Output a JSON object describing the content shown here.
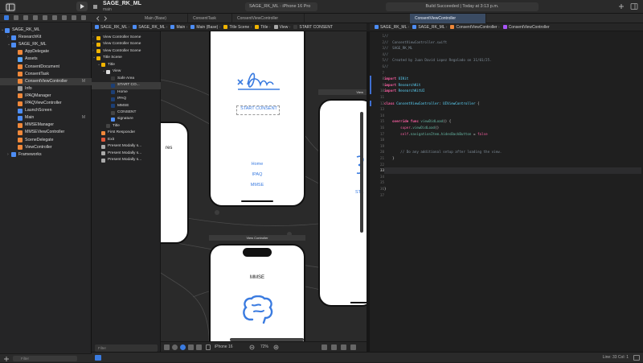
{
  "titlebar": {
    "project_name": "SAGE_RK_ML",
    "project_branch": "main",
    "scheme": "SAGE_RK_ML",
    "destination": "iPhone 16 Pro",
    "build_status": "Build Succeeded | Today at 3:13 p.m."
  },
  "navigator": {
    "filter_placeholder": "Filter",
    "items": [
      {
        "label": "SAGE_RK_ML",
        "kind": "project",
        "badge": ""
      },
      {
        "label": "ResearchKit",
        "kind": "project",
        "badge": ""
      },
      {
        "label": "SAGE_RK_ML",
        "kind": "folder",
        "badge": ""
      },
      {
        "label": "AppDelegate",
        "kind": "swift",
        "badge": ""
      },
      {
        "label": "Assets",
        "kind": "assets",
        "badge": ""
      },
      {
        "label": "ConsentDocument",
        "kind": "swift",
        "badge": ""
      },
      {
        "label": "ConsentTask",
        "kind": "swift",
        "badge": ""
      },
      {
        "label": "ConsentViewController",
        "kind": "swift",
        "badge": "M",
        "selected": true
      },
      {
        "label": "Info",
        "kind": "plist",
        "badge": ""
      },
      {
        "label": "IPAQManager",
        "kind": "swift",
        "badge": ""
      },
      {
        "label": "IPAQViewController",
        "kind": "swift",
        "badge": ""
      },
      {
        "label": "LaunchScreen",
        "kind": "storyboard",
        "badge": ""
      },
      {
        "label": "Main",
        "kind": "storyboard",
        "badge": "M"
      },
      {
        "label": "MMSEManager",
        "kind": "swift",
        "badge": ""
      },
      {
        "label": "MMSEViewController",
        "kind": "swift",
        "badge": ""
      },
      {
        "label": "SceneDelegate",
        "kind": "swift",
        "badge": ""
      },
      {
        "label": "ViewController",
        "kind": "swift",
        "badge": ""
      },
      {
        "label": "Frameworks",
        "kind": "folder",
        "badge": ""
      }
    ]
  },
  "tabs": [
    {
      "label": "Main (Base)",
      "active": false
    },
    {
      "label": "ConsentTask",
      "active": false
    },
    {
      "label": "ConsentViewController",
      "active": false
    },
    {
      "label": "ConsentViewController",
      "active": true
    }
  ],
  "left_jumpbar": [
    "SAGE_RK_ML",
    "SAGE_RK_ML",
    "Main",
    "Main (Base)",
    "Title Scene",
    "Title",
    "View",
    "START CONSENT"
  ],
  "right_jumpbar": [
    "SAGE_RK_ML",
    "SAGE_RK_ML",
    "ConsentViewController",
    "ConsentViewController"
  ],
  "outline": {
    "filter_placeholder": "Filter",
    "items": [
      {
        "label": "View Controller Scene",
        "depth": 0,
        "kind": "scene"
      },
      {
        "label": "View Controller Scene",
        "depth": 0,
        "kind": "scene"
      },
      {
        "label": "View Controller Scene",
        "depth": 0,
        "kind": "scene"
      },
      {
        "label": "Title Scene",
        "depth": 0,
        "kind": "scene"
      },
      {
        "label": "Title",
        "depth": 1,
        "kind": "vc"
      },
      {
        "label": "View",
        "depth": 2,
        "kind": "view"
      },
      {
        "label": "Safe Area",
        "depth": 3,
        "kind": "area"
      },
      {
        "label": "START CO...",
        "depth": 3,
        "kind": "button",
        "selected": true
      },
      {
        "label": "Home",
        "depth": 3,
        "kind": "button"
      },
      {
        "label": "IPAQ",
        "depth": 3,
        "kind": "button"
      },
      {
        "label": "MMSE",
        "depth": 3,
        "kind": "button"
      },
      {
        "label": "CONSENT",
        "depth": 3,
        "kind": "label"
      },
      {
        "label": "signature",
        "depth": 3,
        "kind": "image"
      },
      {
        "label": "Title",
        "depth": 2,
        "kind": "item"
      },
      {
        "label": "First Responder",
        "depth": 1,
        "kind": "responder"
      },
      {
        "label": "Exit",
        "depth": 1,
        "kind": "exit"
      },
      {
        "label": "Present Modally s...",
        "depth": 1,
        "kind": "segue"
      },
      {
        "label": "Present Modally s...",
        "depth": 1,
        "kind": "segue"
      },
      {
        "label": "Present Modally s...",
        "depth": 1,
        "kind": "segue"
      }
    ]
  },
  "canvas": {
    "title_scene": {
      "consent_button": "START CONSENT",
      "buttons": [
        "Home",
        "IPAQ",
        "MMSE"
      ]
    },
    "left_phone_fragment": "res",
    "view_controller_label": "View Controller",
    "mmse_scene_title": "MMSE",
    "right_phone_fragment": "STA",
    "right_scene_label": "View",
    "device": "iPhone 16",
    "zoom": "72%"
  },
  "code": {
    "lines": [
      {
        "n": 1,
        "t": "//"
      },
      {
        "n": 2,
        "t": "//  ConsentViewController.swift"
      },
      {
        "n": 3,
        "t": "//  SAGE_RK_ML"
      },
      {
        "n": 4,
        "t": "//"
      },
      {
        "n": 5,
        "t": "//  Created by Juan David Lopez Regalado on 31/01/25."
      },
      {
        "n": 6,
        "t": "//"
      },
      {
        "n": 7,
        "t": ""
      },
      {
        "n": 8,
        "t": "import UIKit"
      },
      {
        "n": 9,
        "t": "import ResearchKit"
      },
      {
        "n": 10,
        "t": "import ResearchKitUI"
      },
      {
        "n": 11,
        "t": ""
      },
      {
        "n": 12,
        "t": "class ConsentViewController: UIViewController {"
      },
      {
        "n": 13,
        "t": ""
      },
      {
        "n": 14,
        "t": ""
      },
      {
        "n": 15,
        "t": "    override func viewDidLoad() {"
      },
      {
        "n": 16,
        "t": "        super.viewDidLoad()"
      },
      {
        "n": 17,
        "t": "        self.navigationItem.hidesBackButton = false"
      },
      {
        "n": 18,
        "t": ""
      },
      {
        "n": 19,
        "t": ""
      },
      {
        "n": 20,
        "t": "        // Do any additional setup after loading the view."
      },
      {
        "n": 21,
        "t": "    }"
      },
      {
        "n": 22,
        "t": ""
      },
      {
        "n": 33,
        "t": ""
      },
      {
        "n": 34,
        "t": ""
      },
      {
        "n": 35,
        "t": ""
      },
      {
        "n": 36,
        "t": "}"
      },
      {
        "n": 37,
        "t": ""
      }
    ]
  },
  "statusbar": {
    "cursor": "Line: 33  Col: 1"
  },
  "colors": {
    "accent": "#3a7be0",
    "swift_orange": "#f0883a",
    "keyword": "#fc5fa3",
    "type": "#5dd8ff",
    "comment": "#7f8c98",
    "function": "#67b7a4",
    "storyboard_blue": "#4d8df5"
  }
}
